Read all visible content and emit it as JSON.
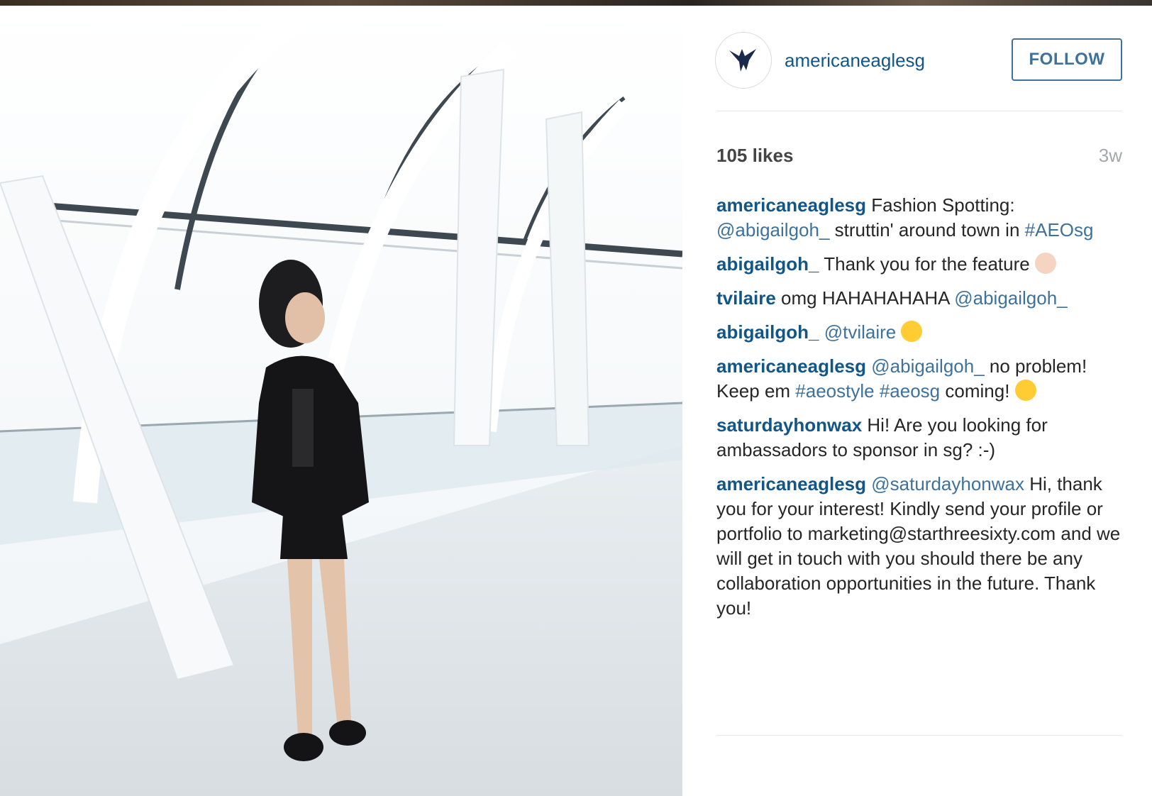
{
  "post": {
    "username": "americaneaglesg",
    "follow_label": "FOLLOW",
    "likes": "105 likes",
    "timestamp": "3w"
  },
  "comments": [
    {
      "user": "americaneaglesg",
      "parts": [
        {
          "type": "text",
          "text": " Fashion Spotting: "
        },
        {
          "type": "tag",
          "text": "@abigailgoh_"
        },
        {
          "type": "text",
          "text": " struttin' around town in "
        },
        {
          "type": "tag",
          "text": "#AEOsg"
        }
      ]
    },
    {
      "user": "abigailgoh_",
      "parts": [
        {
          "type": "text",
          "text": " Thank you for the feature "
        },
        {
          "type": "emoji",
          "name": "person-gesturing-ok-emoji"
        }
      ]
    },
    {
      "user": "tvilaire",
      "parts": [
        {
          "type": "text",
          "text": " omg HAHAHAHAHA "
        },
        {
          "type": "tag",
          "text": "@abigailgoh_"
        }
      ]
    },
    {
      "user": "abigailgoh_",
      "parts": [
        {
          "type": "text",
          "text": " "
        },
        {
          "type": "tag",
          "text": "@tvilaire"
        },
        {
          "type": "text",
          "text": " "
        },
        {
          "type": "emoji",
          "name": "face-with-tears-of-joy-emoji"
        }
      ]
    },
    {
      "user": "americaneaglesg",
      "parts": [
        {
          "type": "text",
          "text": " "
        },
        {
          "type": "tag",
          "text": "@abigailgoh_"
        },
        {
          "type": "text",
          "text": " no problem! Keep em "
        },
        {
          "type": "tag",
          "text": "#aeostyle"
        },
        {
          "type": "text",
          "text": " "
        },
        {
          "type": "tag",
          "text": "#aeosg"
        },
        {
          "type": "text",
          "text": " coming! "
        },
        {
          "type": "emoji",
          "name": "smiling-face-emoji"
        }
      ]
    },
    {
      "user": "saturdayhonwax",
      "parts": [
        {
          "type": "text",
          "text": " Hi! Are you looking for ambassadors to sponsor in sg? :-)"
        }
      ]
    },
    {
      "user": "americaneaglesg",
      "parts": [
        {
          "type": "text",
          "text": " "
        },
        {
          "type": "tag",
          "text": "@saturdayhonwax"
        },
        {
          "type": "text",
          "text": " Hi, thank you for your interest! Kindly send your profile or portfolio to marketing@starthreesixty.com and we will get in touch with you should there be any collaboration opportunities in the future. Thank you!"
        }
      ]
    }
  ],
  "colors": {
    "username_blue": "#125688",
    "tag_blue": "#3f729b",
    "follow_border": "#3f729b",
    "timestamp_gray": "#a5a7aa"
  },
  "icons": {
    "avatar": "eagle-logo-icon"
  }
}
